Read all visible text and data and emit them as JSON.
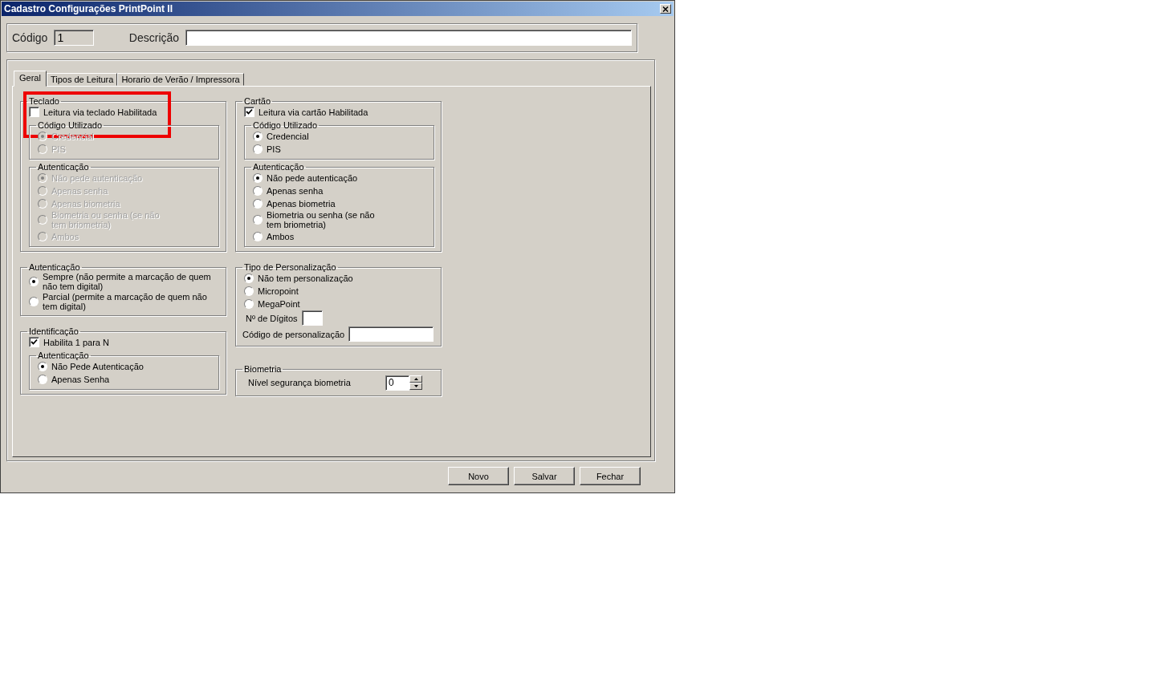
{
  "window": {
    "title": "Cadastro Configurações PrintPoint II"
  },
  "header": {
    "code_label": "Código",
    "code_value": "1",
    "description_label": "Descrição"
  },
  "tabs": [
    {
      "label": "Geral",
      "selected": true
    },
    {
      "label": "Tipos de Leitura",
      "selected": false
    },
    {
      "label": "Horario de Verão / Impressora",
      "selected": false
    }
  ],
  "left_groups": [
    {
      "title": "Teclado",
      "disabled": false,
      "highlighted": true,
      "items": [
        {
          "kind": "checkbox",
          "label": "Leitura via teclado Habilitada",
          "checked": false
        },
        {
          "kind": "group",
          "title": "Código Utilizado",
          "disabled": true,
          "items": [
            {
              "kind": "radio",
              "label": "Credencial",
              "selected": true
            },
            {
              "kind": "radio",
              "label": "PIS",
              "selected": false
            }
          ]
        },
        {
          "kind": "group",
          "title": "Autenticação",
          "disabled": true,
          "items": [
            {
              "kind": "radio",
              "label": "Não pede autenticação",
              "selected": true
            },
            {
              "kind": "radio",
              "label": "Apenas senha",
              "selected": false
            },
            {
              "kind": "radio",
              "label": "Apenas biometria",
              "selected": false
            },
            {
              "kind": "radio",
              "label": "Biometria ou senha (se não\ntem briometria)",
              "selected": false
            },
            {
              "kind": "radio",
              "label": "Ambos",
              "selected": false
            }
          ]
        }
      ]
    },
    {
      "title": "Autenticação",
      "disabled": false,
      "highlighted": false,
      "items": [
        {
          "kind": "radio",
          "label": "Sempre (não permite a marcação de quem\nnão tem digital)",
          "selected": true
        },
        {
          "kind": "radio",
          "label": "Parcial (permite a marcação de quem não\ntem digital)",
          "selected": false
        }
      ]
    },
    {
      "title": "Identificação",
      "disabled": false,
      "highlighted": false,
      "items": [
        {
          "kind": "checkbox",
          "label": "Habilita 1 para N",
          "checked": true
        },
        {
          "kind": "group",
          "title": "Autenticação",
          "disabled": false,
          "items": [
            {
              "kind": "radio",
              "label": "Não Pede Autenticação",
              "selected": true
            },
            {
              "kind": "radio",
              "label": "Apenas Senha",
              "selected": false
            }
          ]
        }
      ]
    }
  ],
  "right_groups": [
    {
      "title": "Cartão",
      "disabled": false,
      "highlighted": false,
      "items": [
        {
          "kind": "checkbox",
          "label": "Leitura via cartão Habilitada",
          "checked": true
        },
        {
          "kind": "group",
          "title": "Código Utilizado",
          "disabled": false,
          "items": [
            {
              "kind": "radio",
              "label": "Credencial",
              "selected": true
            },
            {
              "kind": "radio",
              "label": "PIS",
              "selected": false
            }
          ]
        },
        {
          "kind": "group",
          "title": "Autenticação",
          "disabled": false,
          "items": [
            {
              "kind": "radio",
              "label": "Não pede autenticação",
              "selected": true
            },
            {
              "kind": "radio",
              "label": "Apenas senha",
              "selected": false
            },
            {
              "kind": "radio",
              "label": "Apenas biometria",
              "selected": false
            },
            {
              "kind": "radio",
              "label": "Biometria ou senha (se não\ntem briometria)",
              "selected": false
            },
            {
              "kind": "radio",
              "label": "Ambos",
              "selected": false
            }
          ]
        }
      ]
    },
    {
      "title": "Tipo de Personalização",
      "disabled": false,
      "highlighted": false,
      "items": [
        {
          "kind": "radio",
          "label": "Não tem personalização",
          "selected": true
        },
        {
          "kind": "radio",
          "label": "Micropoint",
          "selected": false
        },
        {
          "kind": "radio",
          "label": "MegaPoint",
          "selected": false
        },
        {
          "kind": "digits_field",
          "label": "Nº de Dígitos"
        },
        {
          "kind": "text_field",
          "label": "Código de personalização"
        }
      ]
    },
    {
      "title": "Biometria",
      "disabled": false,
      "highlighted": false,
      "items": [
        {
          "kind": "spin",
          "label": "Nível segurança biometria",
          "value": "0"
        }
      ]
    }
  ],
  "buttons": [
    "Novo",
    "Salvar",
    "Fechar"
  ]
}
